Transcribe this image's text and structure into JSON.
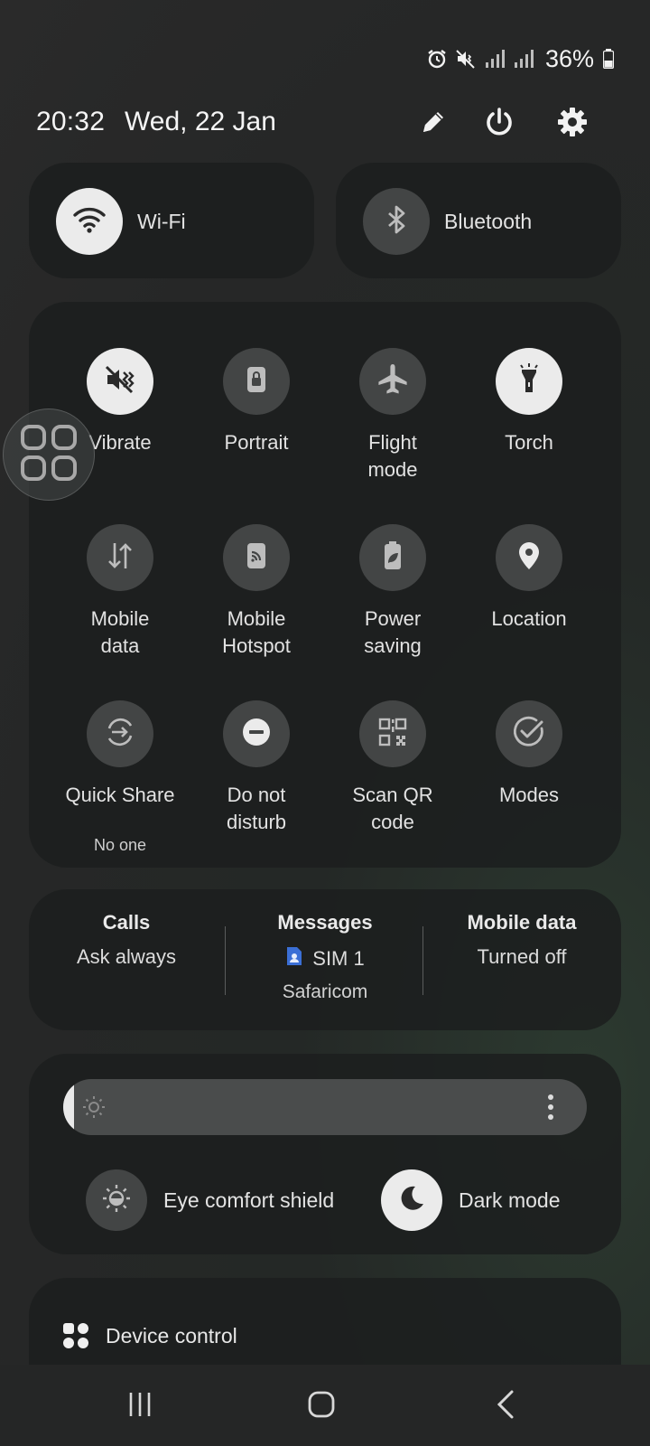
{
  "status_bar": {
    "icons": [
      "alarm-icon",
      "mute-icon",
      "signal-icon",
      "signal-icon"
    ],
    "battery": "36%"
  },
  "header": {
    "time": "20:32",
    "date": "Wed, 22 Jan",
    "icons": [
      "pencil-icon",
      "power-icon",
      "gear-icon"
    ]
  },
  "connectivity": [
    {
      "label": "Wi-Fi",
      "state": "on",
      "icon": "wifi-icon"
    },
    {
      "label": "Bluetooth",
      "state": "off",
      "icon": "bluetooth-icon"
    }
  ],
  "tiles": [
    {
      "label": "Vibrate",
      "state": "on",
      "icon": "vibrate-icon"
    },
    {
      "label": "Portrait",
      "state": "off",
      "icon": "lock-rotation-icon"
    },
    {
      "label": "Flight\nmode",
      "state": "off",
      "icon": "airplane-icon"
    },
    {
      "label": "Torch",
      "state": "on",
      "icon": "flashlight-icon"
    },
    {
      "label": "Mobile\ndata",
      "state": "off",
      "icon": "data-arrows-icon"
    },
    {
      "label": "Mobile\nHotspot",
      "state": "off",
      "icon": "hotspot-icon"
    },
    {
      "label": "Power\nsaving",
      "state": "off",
      "icon": "power-saving-icon"
    },
    {
      "label": "Location",
      "state": "off",
      "icon": "location-pin-icon"
    },
    {
      "label": "Quick Share",
      "sub": "No one",
      "state": "off",
      "icon": "quick-share-icon"
    },
    {
      "label": "Do not\ndisturb",
      "state": "off",
      "icon": "dnd-icon"
    },
    {
      "label": "Scan QR\ncode",
      "state": "off",
      "icon": "qr-code-icon"
    },
    {
      "label": "Modes",
      "state": "off",
      "icon": "modes-check-icon"
    }
  ],
  "sim": {
    "calls": {
      "title": "Calls",
      "value": "Ask always"
    },
    "messages": {
      "title": "Messages",
      "value": "SIM 1",
      "sub": "Safaricom"
    },
    "mobile_data": {
      "title": "Mobile data",
      "value": "Turned off"
    }
  },
  "display": {
    "brightness_fraction": 0.02,
    "eye_comfort_label": "Eye comfort shield",
    "dark_mode_label": "Dark mode"
  },
  "device_control": {
    "label": "Device control"
  },
  "nav": {
    "icons": [
      "recents-icon",
      "home-icon",
      "back-icon"
    ]
  },
  "colors": {
    "tile_on": "#ebebeb",
    "tile_off": "#434545",
    "card": "#1c1e1e"
  }
}
